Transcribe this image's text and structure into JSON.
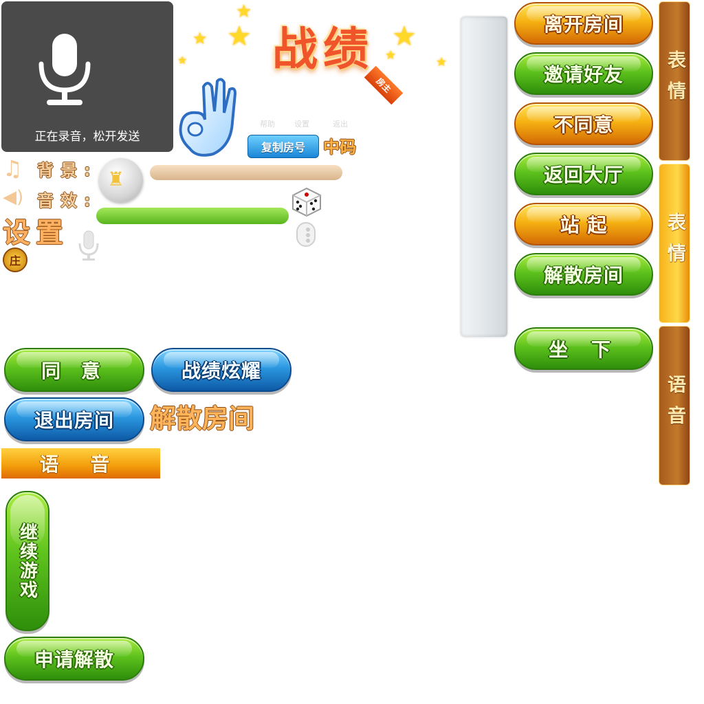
{
  "recording": {
    "text": "正在录音，松开发送",
    "icon": "microphone-icon"
  },
  "title": {
    "text": "战绩"
  },
  "host_ribbon": {
    "text": "房主"
  },
  "small_links": {
    "help": "帮助",
    "settings": "设置",
    "exit": "返出"
  },
  "copy_room": {
    "button": "复制房号",
    "code_label": "中码"
  },
  "settings_panel": {
    "background_label": "背景:",
    "effects_label": "音效:",
    "title": "设置",
    "badge": "庄",
    "background_volume": 0.0,
    "effects_volume": 1.0
  },
  "right_menu": [
    {
      "label": "离开房间",
      "style": "orange"
    },
    {
      "label": "邀请好友",
      "style": "green"
    },
    {
      "label": "不同意",
      "style": "orange"
    },
    {
      "label": "返回大厅",
      "style": "green"
    },
    {
      "label": "站 起",
      "style": "orange"
    },
    {
      "label": "解散房间",
      "style": "green"
    },
    {
      "label": "坐 下",
      "style": "green"
    }
  ],
  "side_tabs": [
    {
      "label": "表情",
      "style": "brown"
    },
    {
      "label": "表情",
      "style": "gold"
    },
    {
      "label": "语音",
      "style": "brown"
    }
  ],
  "bottom_buttons": {
    "agree": "同 意",
    "share_record": "战绩炫耀",
    "exit_room": "退出房间",
    "dissolve_room_text": "解散房间",
    "voice_bar": "语 音",
    "continue_game": "继续游戏",
    "apply_dissolve": "申请解散"
  },
  "colors": {
    "green": "#5ec21d",
    "orange": "#f6b212",
    "blue": "#2b97e0",
    "brown": "#a65a1c"
  }
}
